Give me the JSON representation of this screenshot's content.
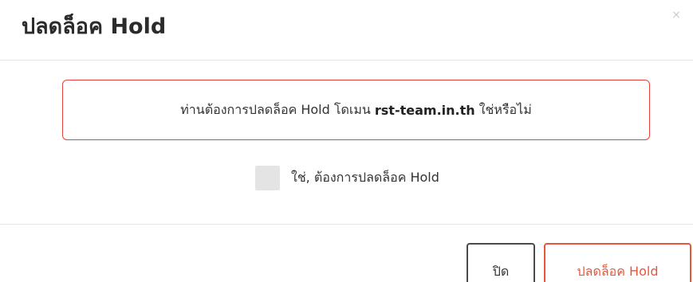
{
  "modal": {
    "title": "ปลดล็อค Hold",
    "close_symbol": "×"
  },
  "alert": {
    "text_before": "ท่านต้องการปลดล็อค Hold โดเมน ",
    "domain": "rst-team.in.th",
    "text_after": " ใช่หรือไม่"
  },
  "confirm": {
    "label": "ใช่, ต้องการปลดล็อค Hold",
    "checked": false
  },
  "footer": {
    "close_label": "ปิด",
    "unlock_label": "ปลดล็อค Hold"
  },
  "colors": {
    "accent": "#e8563a",
    "alert_border": "#e8403d",
    "checkbox_bg": "#e4e4e4"
  }
}
